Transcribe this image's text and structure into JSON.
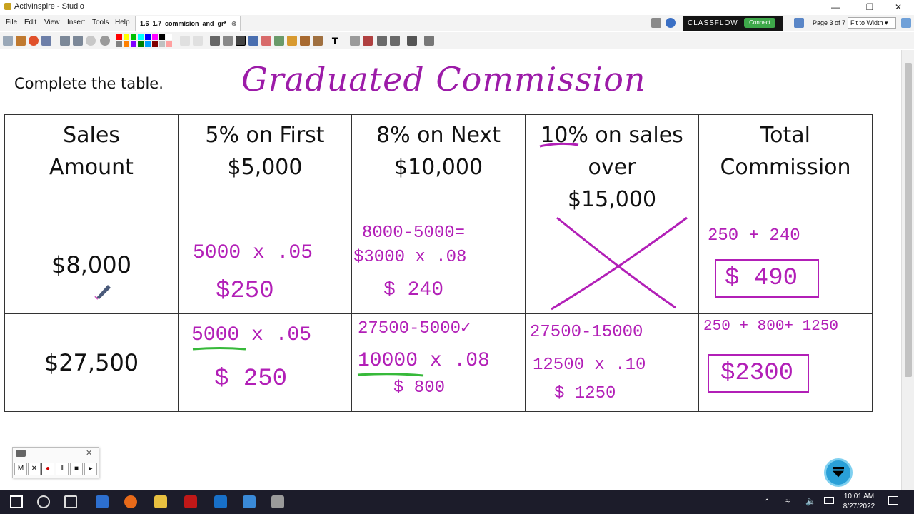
{
  "window": {
    "title": "ActivInspire - Studio"
  },
  "menubar": {
    "items": [
      "File",
      "Edit",
      "View",
      "Insert",
      "Tools",
      "Help"
    ],
    "doc_tab": "1.6_1.7_commision_and_gr*",
    "classflow_label": "CLASSFLOW",
    "connect_label": "Connect",
    "page_info": "Page 3 of 7",
    "zoom_value": "Fit to Width"
  },
  "colors": {
    "ink_purple": "#b21fb7",
    "ink_green": "#37b93a",
    "classflow_bg": "#141414",
    "connect_green": "#3ea84a",
    "taskbar": "#1c1c2a"
  },
  "palette": [
    "#ff0000",
    "#ffff00",
    "#00c000",
    "#00ffff",
    "#0000ff",
    "#ff00ff",
    "#000000",
    "#ffffff",
    "#808080",
    "#ff8000",
    "#8000ff",
    "#008000",
    "#00a0ff",
    "#800000",
    "#c0c0c0",
    "#ffa0a0"
  ],
  "canvas": {
    "instruction": "Complete the table.",
    "handwritten_title": "Graduated Commission"
  },
  "table": {
    "headers": [
      [
        "Sales",
        "Amount"
      ],
      [
        "5% on First",
        "$5,000"
      ],
      [
        "8% on Next",
        "$10,000"
      ],
      [
        "10% on sales",
        "over",
        "$15,000"
      ],
      [
        "Total",
        "Commission"
      ]
    ],
    "rows": [
      {
        "sales": "$8,000",
        "first": [
          "5000 x .05",
          "$250"
        ],
        "next": [
          "8000-5000=",
          "$3000 x .08",
          "$ 240"
        ],
        "over": "",
        "total": [
          "250 + 240",
          "$ 490"
        ]
      },
      {
        "sales": "$27,500",
        "first": [
          "5000 x .05",
          "$ 250"
        ],
        "next": [
          "27500-5000✓",
          "10000 x .08",
          "$ 800"
        ],
        "over": [
          "27500-15000",
          "12500 x .10",
          "$ 1250"
        ],
        "total": [
          "250 + 800+ 1250",
          "$2300"
        ]
      }
    ]
  },
  "recorder": {
    "buttons": [
      "M",
      "✕",
      "●",
      "‖",
      "■",
      "▸"
    ]
  },
  "taskbar": {
    "time": "10:01 AM",
    "date": "8/27/2022"
  }
}
